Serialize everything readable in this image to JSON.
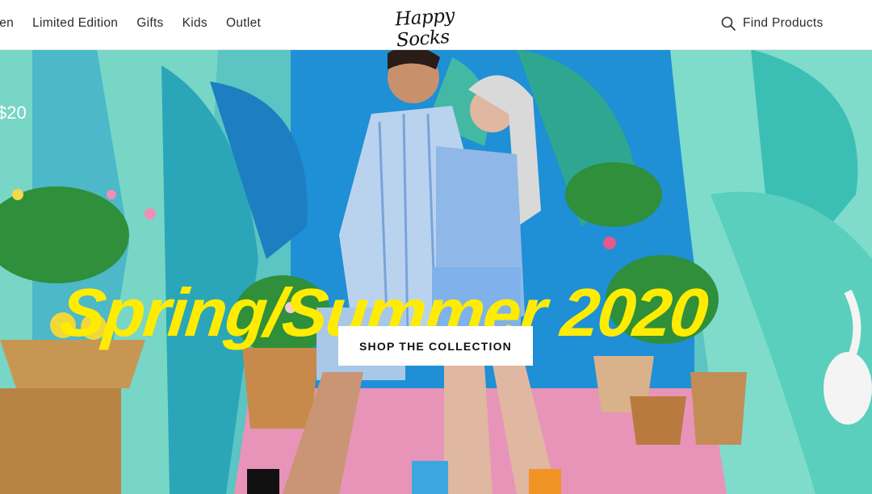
{
  "header": {
    "nav_items": [
      "men",
      "Limited Edition",
      "Gifts",
      "Kids",
      "Outlet"
    ],
    "logo_text": "Happy Socks",
    "search_label": "Find Products"
  },
  "hero": {
    "partial_price_text": "$20",
    "headline": "Spring/Summer 2020",
    "cta_label": "SHOP THE COLLECTION"
  },
  "colors": {
    "headline_yellow": "#ffec00",
    "backdrop_teal": "#4fc3c2",
    "floor_pink": "#e894b8",
    "header_bg": "#ffffff"
  },
  "icons": {
    "search": "magnifier"
  }
}
